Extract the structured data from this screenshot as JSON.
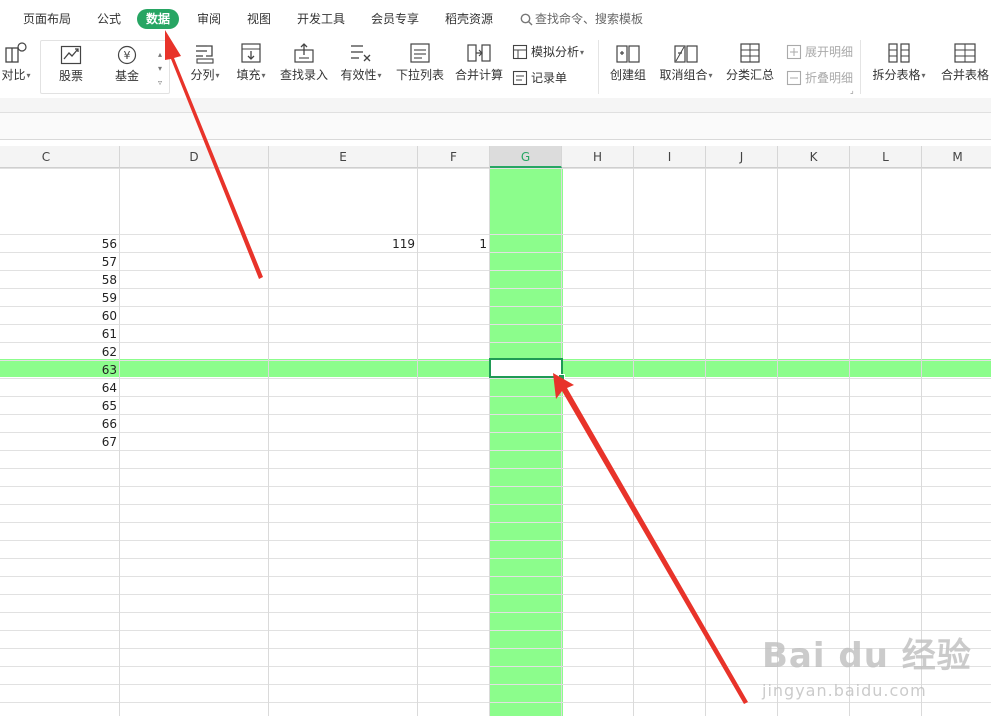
{
  "menu": {
    "tabs": [
      "页面布局",
      "公式",
      "数据",
      "审阅",
      "视图",
      "开发工具",
      "会员专享",
      "稻壳资源"
    ],
    "active_tab": "数据",
    "search_label": "查找命令、搜索模板"
  },
  "ribbon": {
    "compare_label": "对比",
    "stock_label": "股票",
    "fund_label": "基金",
    "split_col_label": "分列",
    "fill_label": "填充",
    "lookup_entry_label": "查找录入",
    "validity_label": "有效性",
    "dropdown_list_label": "下拉列表",
    "consolidate_label": "合并计算",
    "what_if_label": "模拟分析",
    "record_form_label": "记录单",
    "create_group_label": "创建组",
    "ungroup_label": "取消组合",
    "subtotal_label": "分类汇总",
    "expand_detail_label": "展开明细",
    "collapse_detail_label": "折叠明细",
    "split_table_label": "拆分表格",
    "merge_table_label": "合并表格"
  },
  "sheet": {
    "columns": [
      "C",
      "D",
      "E",
      "F",
      "G",
      "H",
      "I",
      "J",
      "K",
      "L",
      "M"
    ],
    "selected_column": "G",
    "active_cell": "G63",
    "c_values": [
      "56",
      "57",
      "58",
      "59",
      "60",
      "61",
      "62",
      "63",
      "64",
      "65",
      "66",
      "67"
    ],
    "e_value": "119",
    "f_value": "1"
  },
  "watermark": {
    "brand": "Bai du 经验",
    "site": "jingyan.baidu.com"
  },
  "colors": {
    "accent": "#27a563",
    "highlight": "#8cfd8c",
    "arrow": "#e8332a"
  }
}
